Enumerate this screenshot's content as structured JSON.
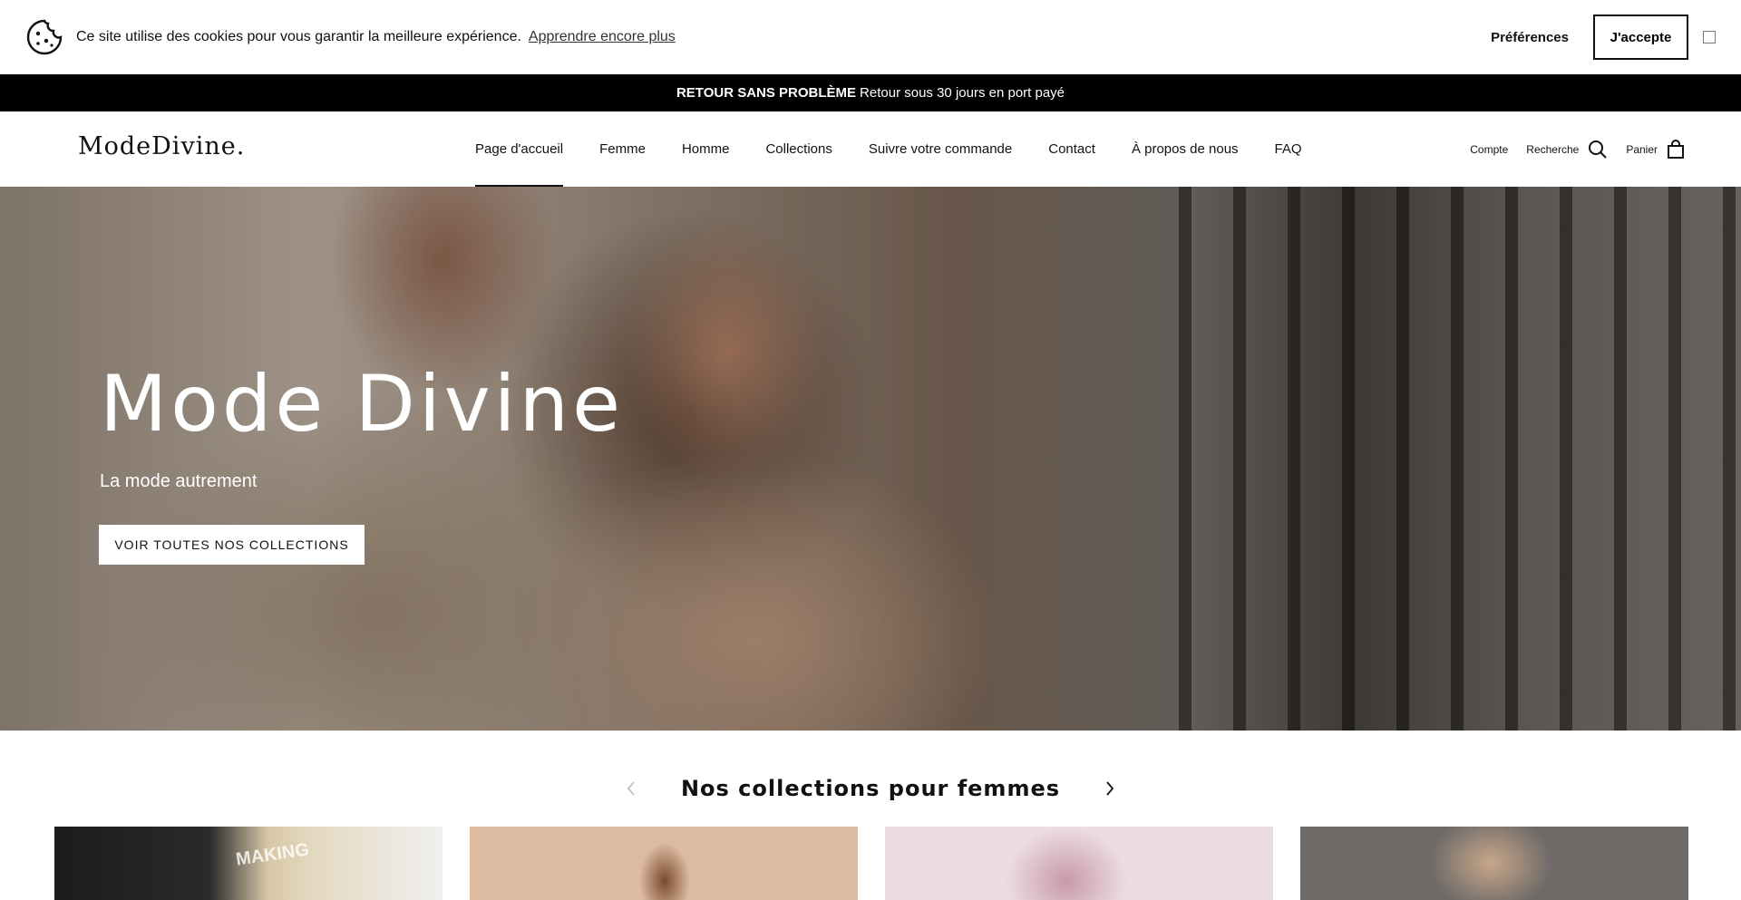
{
  "cookie": {
    "text": "Ce site utilise des cookies pour vous garantir la meilleure expérience.",
    "link": "Apprendre encore plus",
    "preferences": "Préférences",
    "accept": "J'accepte",
    "icon": "cookie-icon"
  },
  "announcement": {
    "bold": "RETOUR SANS PROBLÈME",
    "text": "Retour sous 30 jours en port payé"
  },
  "header": {
    "logo": "ModeDivine.",
    "nav": [
      {
        "label": "Page d'accueil",
        "active": true
      },
      {
        "label": "Femme"
      },
      {
        "label": "Homme"
      },
      {
        "label": "Collections"
      },
      {
        "label": "Suivre votre commande"
      },
      {
        "label": "Contact"
      },
      {
        "label": "À propos de nous"
      },
      {
        "label": "FAQ"
      }
    ],
    "account": "Compte",
    "search": "Recherche",
    "cart": "Panier"
  },
  "hero": {
    "title": "Mode Divine",
    "subtitle": "La mode autrement",
    "button": "VOIR TOUTES NOS COLLECTIONS"
  },
  "collections": {
    "title": "Nos collections pour femmes",
    "card1_text": "MAKING"
  }
}
